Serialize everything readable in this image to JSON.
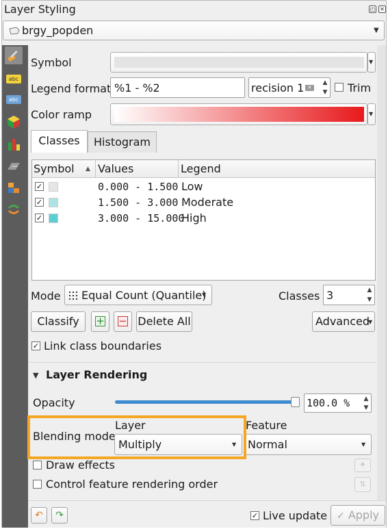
{
  "window": {
    "title": "Layer Styling"
  },
  "layer_selector": {
    "value": "brgy_popden"
  },
  "symbology": {
    "symbol_label": "Symbol",
    "legend_format_label": "Legend format",
    "legend_format_value": "%1 - %2",
    "precision_value": "recision 1",
    "trim_label": "Trim",
    "color_ramp_label": "Color ramp",
    "tabs": [
      {
        "label": "Classes",
        "active": true
      },
      {
        "label": "Histogram",
        "active": false
      }
    ],
    "table": {
      "headers": [
        "Symbol",
        "Values",
        "Legend"
      ],
      "rows": [
        {
          "checked": "✓",
          "color": "#e6e6e6",
          "values": "0.000 - 1.500",
          "legend": "Low"
        },
        {
          "checked": "✓",
          "color": "#aee3e4",
          "values": "1.500 - 3.000",
          "legend": "Moderate"
        },
        {
          "checked": "✓",
          "color": "#5ccfd2",
          "values": "3.000 - 15.000",
          "legend": "High"
        }
      ]
    },
    "mode_label": "Mode",
    "mode_value": "Equal Count (Quantile)",
    "classes_label": "Classes",
    "classes_value": "3",
    "classify_button": "Classify",
    "delete_all_button": "Delete All",
    "advanced_button": "Advanced",
    "link_boundaries_label": "Link class boundaries"
  },
  "layer_rendering": {
    "section_title": "Layer Rendering",
    "opacity_label": "Opacity",
    "opacity_value": "100.0 %",
    "opacity_level": 1.0,
    "blending_mode_label": "Blending mode",
    "layer_col_label": "Layer",
    "feature_col_label": "Feature",
    "layer_blend_value": "Multiply",
    "feature_blend_value": "Normal",
    "draw_effects_label": "Draw effects",
    "control_order_label": "Control feature rendering order"
  },
  "footer": {
    "live_update_label": "Live update",
    "apply_button": "Apply"
  },
  "colors": {
    "highlight": "#f5a623",
    "ramp_start": "#ffffff",
    "ramp_end": "#e8191c",
    "sidebar": "#5c5c5c"
  }
}
